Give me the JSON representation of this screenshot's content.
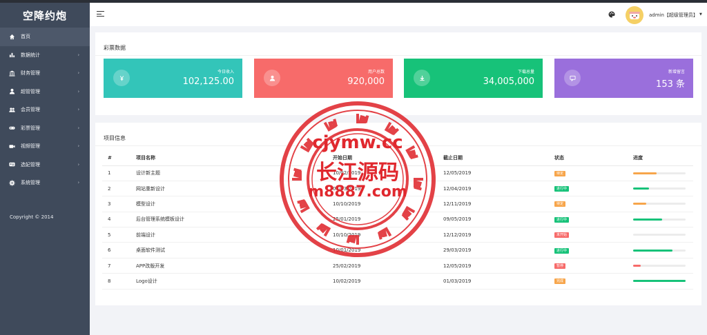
{
  "app": {
    "title": "空降约炮"
  },
  "sidebar": {
    "items": [
      {
        "label": "首页",
        "icon": "home-icon",
        "active": true,
        "submenu": false
      },
      {
        "label": "数据统计",
        "icon": "bar-chart-icon",
        "submenu": true
      },
      {
        "label": "财务管理",
        "icon": "bank-icon",
        "submenu": true
      },
      {
        "label": "超管管理",
        "icon": "user-icon",
        "submenu": true
      },
      {
        "label": "会员管理",
        "icon": "users-icon",
        "submenu": true
      },
      {
        "label": "彩票管理",
        "icon": "gamepad-icon",
        "submenu": true
      },
      {
        "label": "视频管理",
        "icon": "video-icon",
        "submenu": true
      },
      {
        "label": "选妃管理",
        "icon": "id-card-icon",
        "submenu": true
      },
      {
        "label": "系统管理",
        "icon": "gear-icon",
        "submenu": true
      }
    ],
    "copyright": "Copyright © 2014"
  },
  "header": {
    "user": "admin【超级管理员】",
    "icons": [
      "menu-icon",
      "palette-icon",
      "avatar",
      "caret-down-icon"
    ]
  },
  "lottery_panel": {
    "title": "彩票数据",
    "cards": [
      {
        "label": "今日收入",
        "value": "102,125.00",
        "color": "#33c5b9",
        "icon": "yen-icon"
      },
      {
        "label": "用户总数",
        "value": "920,000",
        "color": "#f76b6a",
        "icon": "user-icon"
      },
      {
        "label": "下载总量",
        "value": "34,005,000",
        "color": "#17c279",
        "icon": "download-icon"
      },
      {
        "label": "新增留言",
        "value": "153 条",
        "color": "#9a6fdc",
        "icon": "message-icon"
      }
    ]
  },
  "project_panel": {
    "title": "项目信息",
    "columns": [
      "#",
      "项目名称",
      "开始日期",
      "截止日期",
      "状态",
      "进度"
    ],
    "rows": [
      {
        "no": "1",
        "name": "设计新主题",
        "start": "10/02/2019",
        "end": "12/05/2019",
        "status": "待定",
        "status_color": "#f7a54a",
        "progress": 45,
        "progress_color": "#f7a54a"
      },
      {
        "no": "2",
        "name": "网站重新设计",
        "start": "01/03/2019",
        "end": "12/04/2019",
        "status": "进行中",
        "status_color": "#17c279",
        "progress": 30,
        "progress_color": "#17c279"
      },
      {
        "no": "3",
        "name": "模型设计",
        "start": "10/10/2019",
        "end": "12/11/2019",
        "status": "待定",
        "status_color": "#f7a54a",
        "progress": 25,
        "progress_color": "#f7a54a"
      },
      {
        "no": "4",
        "name": "后台管理系统模板设计",
        "start": "25/01/2019",
        "end": "09/05/2019",
        "status": "进行中",
        "status_color": "#17c279",
        "progress": 55,
        "progress_color": "#17c279"
      },
      {
        "no": "5",
        "name": "前端设计",
        "start": "10/10/2019",
        "end": "12/12/2019",
        "status": "未开始",
        "status_color": "#f76b6a",
        "progress": 0,
        "progress_color": "#f76b6a"
      },
      {
        "no": "6",
        "name": "桌面软件测试",
        "start": "10/01/2019",
        "end": "29/03/2019",
        "status": "进行中",
        "status_color": "#17c279",
        "progress": 75,
        "progress_color": "#17c279"
      },
      {
        "no": "7",
        "name": "APP改版开发",
        "start": "25/02/2019",
        "end": "12/05/2019",
        "status": "暂停",
        "status_color": "#f76b6a",
        "progress": 15,
        "progress_color": "#f76b6a"
      },
      {
        "no": "8",
        "name": "Logo设计",
        "start": "10/02/2019",
        "end": "01/03/2019",
        "status": "完成",
        "status_color": "#f7a54a",
        "progress": 100,
        "progress_color": "#17c279"
      }
    ]
  },
  "watermark": {
    "line1": "cjymw.cc",
    "line2": "长江源码",
    "line3": "m8887.com",
    "color": "#e0282e"
  }
}
